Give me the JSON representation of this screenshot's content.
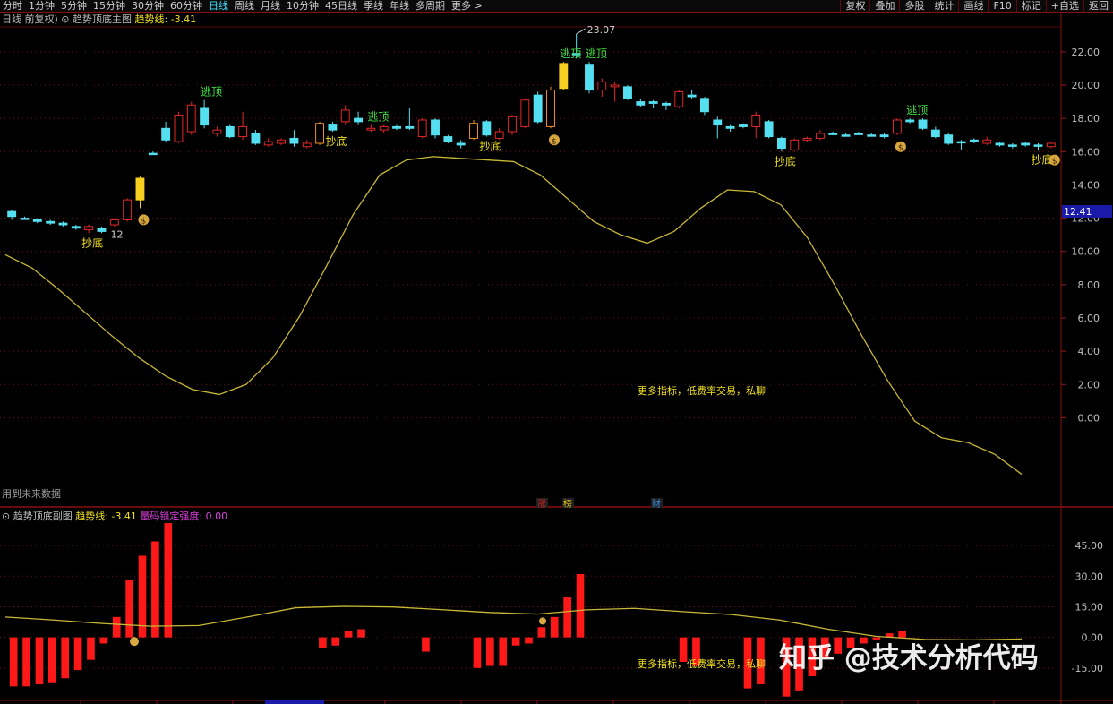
{
  "toolbar": {
    "tabs": [
      "分时",
      "1分钟",
      "5分钟",
      "15分钟",
      "30分钟",
      "60分钟",
      "日线",
      "周线",
      "月线",
      "10分钟",
      "45日线",
      "季线",
      "年线",
      "多周期",
      "更多 >"
    ],
    "active_tab": "日线",
    "right_buttons": [
      "复权",
      "叠加",
      "多股",
      "统计",
      "画线",
      "F10",
      "标记",
      "+自选",
      "返回"
    ]
  },
  "main_header": {
    "period": "日线 前复权)",
    "indicator_name": "趋势顶底主图",
    "trend_label": "趋势线: -3.41"
  },
  "sub_header": {
    "indicator_name": "趋势顶底副图",
    "trend_label": "趋势线: -3.41",
    "lock_label": "量码锁定强度: 0.00"
  },
  "main_notice": "用到未来数据",
  "ad_text": "更多指标，低费率交易，私聊",
  "watermark": "知乎 @技术分析代码",
  "markers": [
    {
      "label": "涨",
      "color": "#e02020"
    },
    {
      "label": "榜",
      "color": "#e0c020"
    },
    {
      "label": "财",
      "color": "#3a8ad8"
    }
  ],
  "current_price": "12.41",
  "chart_data": [
    {
      "type": "candlestick",
      "title": "趋势顶底主图",
      "y_ticks": [
        "22.00",
        "20.00",
        "18.00",
        "16.00",
        "14.00",
        "12.00",
        "10.00",
        "8.00",
        "6.00",
        "4.00",
        "2.00",
        "0.00"
      ],
      "ylim": [
        -4.5,
        23.5
      ],
      "annotations": {
        "high": "23.07",
        "low": "12"
      },
      "signals": {
        "escape": "逃顶",
        "bottom": "抄底"
      },
      "candles": [
        {
          "o": 12.1,
          "c": 12.4,
          "h": 12.5,
          "l": 11.9,
          "t": "c"
        },
        {
          "o": 12.0,
          "c": 12.0,
          "h": 12.1,
          "l": 11.9,
          "t": "c"
        },
        {
          "o": 11.9,
          "c": 11.8,
          "h": 12.0,
          "l": 11.7,
          "t": "c"
        },
        {
          "o": 11.8,
          "c": 11.7,
          "h": 11.9,
          "l": 11.6,
          "t": "c"
        },
        {
          "o": 11.7,
          "c": 11.6,
          "h": 11.8,
          "l": 11.5,
          "t": "c"
        },
        {
          "o": 11.5,
          "c": 11.4,
          "h": 11.6,
          "l": 11.3,
          "t": "c"
        },
        {
          "o": 11.3,
          "c": 11.5,
          "h": 11.6,
          "l": 11.1,
          "t": "r"
        },
        {
          "o": 11.4,
          "c": 11.2,
          "h": 11.5,
          "l": 11.1,
          "t": "c"
        },
        {
          "o": 11.6,
          "c": 11.9,
          "h": 12.0,
          "l": 11.5,
          "t": "r"
        },
        {
          "o": 11.9,
          "c": 13.1,
          "h": 13.2,
          "l": 11.8,
          "t": "r"
        },
        {
          "o": 13.1,
          "c": 14.4,
          "h": 14.5,
          "l": 12.6,
          "t": "y"
        },
        {
          "o": 15.9,
          "c": 15.9,
          "h": 16.0,
          "l": 15.8,
          "t": "c"
        },
        {
          "o": 17.4,
          "c": 16.7,
          "h": 17.8,
          "l": 16.6,
          "t": "c"
        },
        {
          "o": 16.6,
          "c": 18.2,
          "h": 18.4,
          "l": 16.5,
          "t": "r"
        },
        {
          "o": 17.2,
          "c": 18.8,
          "h": 19.0,
          "l": 17.0,
          "t": "r"
        },
        {
          "o": 18.6,
          "c": 17.6,
          "h": 19.1,
          "l": 17.4,
          "t": "c"
        },
        {
          "o": 17.3,
          "c": 17.1,
          "h": 17.5,
          "l": 16.9,
          "t": "r"
        },
        {
          "o": 17.5,
          "c": 16.9,
          "h": 17.6,
          "l": 16.8,
          "t": "c"
        },
        {
          "o": 16.9,
          "c": 17.5,
          "h": 18.4,
          "l": 16.7,
          "t": "r"
        },
        {
          "o": 17.1,
          "c": 16.5,
          "h": 17.3,
          "l": 16.4,
          "t": "c"
        },
        {
          "o": 16.4,
          "c": 16.6,
          "h": 16.8,
          "l": 16.3,
          "t": "r"
        },
        {
          "o": 16.5,
          "c": 16.7,
          "h": 16.8,
          "l": 16.4,
          "t": "r"
        },
        {
          "o": 16.8,
          "c": 16.5,
          "h": 17.3,
          "l": 16.3,
          "t": "c"
        },
        {
          "o": 16.3,
          "c": 16.5,
          "h": 16.7,
          "l": 16.2,
          "t": "r"
        },
        {
          "o": 16.5,
          "c": 17.7,
          "h": 17.8,
          "l": 16.4,
          "t": "o"
        },
        {
          "o": 17.6,
          "c": 17.3,
          "h": 17.8,
          "l": 17.2,
          "t": "c"
        },
        {
          "o": 17.8,
          "c": 18.5,
          "h": 18.8,
          "l": 17.6,
          "t": "r"
        },
        {
          "o": 18.0,
          "c": 17.8,
          "h": 18.4,
          "l": 17.6,
          "t": "c"
        },
        {
          "o": 17.3,
          "c": 17.4,
          "h": 17.6,
          "l": 17.2,
          "t": "r"
        },
        {
          "o": 17.3,
          "c": 17.5,
          "h": 17.6,
          "l": 17.1,
          "t": "r"
        },
        {
          "o": 17.5,
          "c": 17.4,
          "h": 17.6,
          "l": 17.3,
          "t": "c"
        },
        {
          "o": 17.5,
          "c": 17.4,
          "h": 18.6,
          "l": 17.3,
          "t": "c"
        },
        {
          "o": 16.9,
          "c": 17.9,
          "h": 18.0,
          "l": 16.8,
          "t": "r"
        },
        {
          "o": 17.9,
          "c": 17.0,
          "h": 18.0,
          "l": 16.8,
          "t": "c"
        },
        {
          "o": 16.9,
          "c": 16.6,
          "h": 17.0,
          "l": 16.5,
          "t": "c"
        },
        {
          "o": 16.5,
          "c": 16.4,
          "h": 16.7,
          "l": 16.2,
          "t": "c"
        },
        {
          "o": 16.8,
          "c": 17.7,
          "h": 17.9,
          "l": 16.7,
          "t": "o"
        },
        {
          "o": 17.8,
          "c": 17.0,
          "h": 17.9,
          "l": 16.9,
          "t": "c"
        },
        {
          "o": 16.8,
          "c": 17.2,
          "h": 17.4,
          "l": 16.7,
          "t": "r"
        },
        {
          "o": 17.2,
          "c": 18.1,
          "h": 18.2,
          "l": 17.0,
          "t": "r"
        },
        {
          "o": 17.5,
          "c": 19.1,
          "h": 19.2,
          "l": 17.4,
          "t": "r"
        },
        {
          "o": 19.4,
          "c": 17.8,
          "h": 19.6,
          "l": 17.7,
          "t": "c"
        },
        {
          "o": 17.5,
          "c": 19.7,
          "h": 19.9,
          "l": 17.4,
          "t": "o"
        },
        {
          "o": 19.8,
          "c": 21.3,
          "h": 21.4,
          "l": 19.7,
          "t": "y"
        },
        {
          "o": 21.9,
          "c": 21.9,
          "h": 23.07,
          "l": 21.6,
          "t": "c"
        },
        {
          "o": 21.2,
          "c": 19.7,
          "h": 21.4,
          "l": 19.5,
          "t": "c"
        },
        {
          "o": 19.7,
          "c": 20.2,
          "h": 20.4,
          "l": 19.3,
          "t": "r"
        },
        {
          "o": 19.9,
          "c": 20.0,
          "h": 20.2,
          "l": 19.0,
          "t": "r"
        },
        {
          "o": 19.9,
          "c": 19.2,
          "h": 20.0,
          "l": 19.1,
          "t": "c"
        },
        {
          "o": 19.0,
          "c": 18.8,
          "h": 19.2,
          "l": 18.7,
          "t": "c"
        },
        {
          "o": 18.9,
          "c": 19.0,
          "h": 19.1,
          "l": 18.6,
          "t": "c"
        },
        {
          "o": 18.8,
          "c": 18.9,
          "h": 19.0,
          "l": 18.5,
          "t": "c"
        },
        {
          "o": 18.7,
          "c": 19.6,
          "h": 19.7,
          "l": 18.6,
          "t": "r"
        },
        {
          "o": 19.4,
          "c": 19.3,
          "h": 19.7,
          "l": 19.2,
          "t": "c"
        },
        {
          "o": 19.2,
          "c": 18.4,
          "h": 19.3,
          "l": 18.2,
          "t": "c"
        },
        {
          "o": 17.9,
          "c": 17.6,
          "h": 18.1,
          "l": 16.8,
          "t": "c"
        },
        {
          "o": 17.4,
          "c": 17.5,
          "h": 17.6,
          "l": 17.2,
          "t": "c"
        },
        {
          "o": 17.5,
          "c": 17.6,
          "h": 17.7,
          "l": 17.4,
          "t": "c"
        },
        {
          "o": 17.5,
          "c": 18.2,
          "h": 18.4,
          "l": 16.8,
          "t": "r"
        },
        {
          "o": 17.8,
          "c": 16.9,
          "h": 17.9,
          "l": 16.8,
          "t": "c"
        },
        {
          "o": 16.8,
          "c": 16.2,
          "h": 16.9,
          "l": 16.0,
          "t": "c"
        },
        {
          "o": 16.1,
          "c": 16.7,
          "h": 16.8,
          "l": 16.0,
          "t": "r"
        },
        {
          "o": 16.7,
          "c": 16.8,
          "h": 16.9,
          "l": 16.6,
          "t": "r"
        },
        {
          "o": 16.8,
          "c": 17.1,
          "h": 17.3,
          "l": 16.7,
          "t": "r"
        },
        {
          "o": 17.1,
          "c": 17.1,
          "h": 17.2,
          "l": 17.0,
          "t": "c"
        },
        {
          "o": 17.0,
          "c": 17.0,
          "h": 17.1,
          "l": 16.9,
          "t": "c"
        },
        {
          "o": 17.1,
          "c": 17.1,
          "h": 17.2,
          "l": 17.0,
          "t": "c"
        },
        {
          "o": 17.0,
          "c": 17.0,
          "h": 17.1,
          "l": 16.9,
          "t": "c"
        },
        {
          "o": 17.0,
          "c": 16.9,
          "h": 17.1,
          "l": 16.8,
          "t": "c"
        },
        {
          "o": 17.1,
          "c": 17.9,
          "h": 18.0,
          "l": 17.0,
          "t": "r"
        },
        {
          "o": 17.9,
          "c": 17.8,
          "h": 18.0,
          "l": 17.7,
          "t": "c"
        },
        {
          "o": 17.9,
          "c": 17.4,
          "h": 18.0,
          "l": 17.3,
          "t": "c"
        },
        {
          "o": 17.3,
          "c": 16.9,
          "h": 17.5,
          "l": 16.8,
          "t": "c"
        },
        {
          "o": 17.0,
          "c": 16.5,
          "h": 17.1,
          "l": 16.4,
          "t": "c"
        },
        {
          "o": 16.6,
          "c": 16.6,
          "h": 16.7,
          "l": 16.1,
          "t": "c"
        },
        {
          "o": 16.6,
          "c": 16.7,
          "h": 16.8,
          "l": 16.5,
          "t": "c"
        },
        {
          "o": 16.5,
          "c": 16.7,
          "h": 16.9,
          "l": 16.4,
          "t": "r"
        },
        {
          "o": 16.5,
          "c": 16.4,
          "h": 16.6,
          "l": 16.3,
          "t": "c"
        },
        {
          "o": 16.4,
          "c": 16.4,
          "h": 16.5,
          "l": 16.2,
          "t": "c"
        },
        {
          "o": 16.4,
          "c": 16.5,
          "h": 16.6,
          "l": 16.3,
          "t": "c"
        },
        {
          "o": 16.4,
          "c": 16.4,
          "h": 16.5,
          "l": 16.1,
          "t": "c"
        },
        {
          "o": 16.3,
          "c": 16.5,
          "h": 16.6,
          "l": 16.2,
          "t": "r"
        }
      ],
      "trend_line": [
        9.8,
        9.0,
        7.7,
        6.3,
        4.9,
        3.6,
        2.5,
        1.7,
        1.4,
        2.0,
        3.6,
        6.1,
        9.1,
        12.2,
        14.6,
        15.5,
        15.7,
        15.6,
        15.5,
        15.4,
        14.6,
        13.2,
        11.8,
        11.0,
        10.5,
        11.2,
        12.6,
        13.7,
        13.6,
        12.8,
        10.8,
        8.0,
        5.0,
        2.2,
        -0.2,
        -1.2,
        -1.5,
        -2.2,
        -3.4
      ],
      "escape_at": [
        15,
        28,
        43,
        45,
        70
      ],
      "bottom_at": [
        6,
        25,
        37,
        60,
        80
      ],
      "moneybags_at": [
        10,
        42,
        69,
        81
      ]
    },
    {
      "type": "bar",
      "title": "趋势顶底副图",
      "y_ticks": [
        "45.00",
        "30.00",
        "15.00",
        "0.00",
        "-15.00"
      ],
      "ylim": [
        -30,
        56
      ],
      "values": [
        -24,
        -24,
        -23,
        -22,
        -20,
        -16,
        -11,
        -3,
        10,
        28,
        40,
        47,
        56,
        0,
        0,
        0,
        0,
        0,
        0,
        0,
        0,
        0,
        0,
        0,
        -5,
        -4,
        3,
        4,
        0,
        0,
        0,
        0,
        -7,
        0,
        0,
        0,
        -15,
        -14,
        -14,
        -4,
        -3,
        5,
        10,
        20,
        31,
        0,
        0,
        0,
        0,
        0,
        0,
        0,
        -12,
        -14,
        0,
        0,
        0,
        -25,
        -23,
        0,
        -29,
        -26,
        -19,
        -10,
        -8,
        -5,
        -3,
        -1,
        2,
        3,
        0,
        0,
        0,
        0,
        0,
        0,
        0,
        0,
        0,
        0,
        0
      ],
      "trend_line": [
        10,
        8.5,
        6.8,
        5.5,
        5.8,
        10,
        14.5,
        15.2,
        14.9,
        13.6,
        12.2,
        11.4,
        13.5,
        14.2,
        12.6,
        11.2,
        8.5,
        4.0,
        0.5,
        -1.0,
        -1.2,
        -0.8
      ]
    }
  ]
}
